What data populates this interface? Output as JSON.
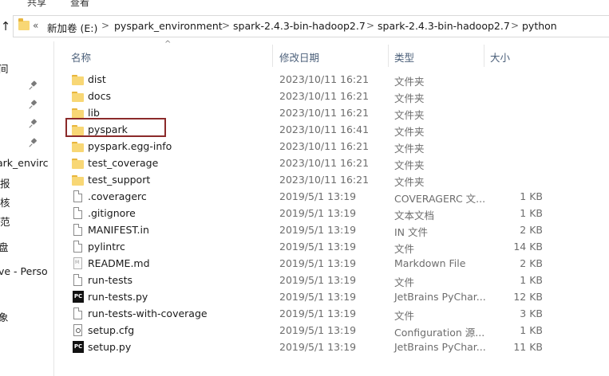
{
  "ribbon": {
    "tabs": [
      "共享",
      "查看"
    ]
  },
  "address": {
    "overflow_chevrons": "«",
    "crumbs": [
      "新加卷 (E:)",
      "pyspark_environment",
      "spark-2.4.3-bin-hadoop2.7",
      "spark-2.4.3-bin-hadoop2.7",
      "python"
    ],
    "separator": ">"
  },
  "nav": {
    "items": [
      "间",
      "ark_envirc",
      "报",
      "核",
      "范",
      "盘",
      "ve - Perso",
      "象"
    ]
  },
  "columns": {
    "name": "名称",
    "modified": "修改日期",
    "type": "类型",
    "size": "大小"
  },
  "files": [
    {
      "name": "dist",
      "modified": "2023/10/11 16:21",
      "type": "文件夹",
      "size": "",
      "icon": "folder-icon"
    },
    {
      "name": "docs",
      "modified": "2023/10/11 16:21",
      "type": "文件夹",
      "size": "",
      "icon": "folder-icon"
    },
    {
      "name": "lib",
      "modified": "2023/10/11 16:21",
      "type": "文件夹",
      "size": "",
      "icon": "folder-icon"
    },
    {
      "name": "pyspark",
      "modified": "2023/10/11 16:41",
      "type": "文件夹",
      "size": "",
      "icon": "folder-icon"
    },
    {
      "name": "pyspark.egg-info",
      "modified": "2023/10/11 16:21",
      "type": "文件夹",
      "size": "",
      "icon": "folder-icon"
    },
    {
      "name": "test_coverage",
      "modified": "2023/10/11 16:21",
      "type": "文件夹",
      "size": "",
      "icon": "folder-icon"
    },
    {
      "name": "test_support",
      "modified": "2023/10/11 16:21",
      "type": "文件夹",
      "size": "",
      "icon": "folder-icon"
    },
    {
      "name": ".coveragerc",
      "modified": "2019/5/1 13:19",
      "type": "COVERAGERC 文...",
      "size": "1 KB",
      "icon": "file-icon"
    },
    {
      "name": ".gitignore",
      "modified": "2019/5/1 13:19",
      "type": "文本文档",
      "size": "1 KB",
      "icon": "text-file-icon"
    },
    {
      "name": "MANIFEST.in",
      "modified": "2019/5/1 13:19",
      "type": "IN 文件",
      "size": "2 KB",
      "icon": "file-icon"
    },
    {
      "name": "pylintrc",
      "modified": "2019/5/1 13:19",
      "type": "文件",
      "size": "14 KB",
      "icon": "file-icon"
    },
    {
      "name": "README.md",
      "modified": "2019/5/1 13:19",
      "type": "Markdown File",
      "size": "2 KB",
      "icon": "markdown-file-icon"
    },
    {
      "name": "run-tests",
      "modified": "2019/5/1 13:19",
      "type": "文件",
      "size": "1 KB",
      "icon": "file-icon"
    },
    {
      "name": "run-tests.py",
      "modified": "2019/5/1 13:19",
      "type": "JetBrains PyChar...",
      "size": "12 KB",
      "icon": "pycharm-file-icon"
    },
    {
      "name": "run-tests-with-coverage",
      "modified": "2019/5/1 13:19",
      "type": "文件",
      "size": "3 KB",
      "icon": "file-icon"
    },
    {
      "name": "setup.cfg",
      "modified": "2019/5/1 13:19",
      "type": "Configuration 源...",
      "size": "1 KB",
      "icon": "config-file-icon"
    },
    {
      "name": "setup.py",
      "modified": "2019/5/1 13:19",
      "type": "JetBrains PyChar...",
      "size": "11 KB",
      "icon": "pycharm-file-icon"
    }
  ],
  "highlighted_file": "pyspark",
  "colors": {
    "folder": "#f8d775",
    "highlight_border": "#8b2a2a",
    "header_text": "#4c607a",
    "secondary_text": "#6d6d6d"
  }
}
